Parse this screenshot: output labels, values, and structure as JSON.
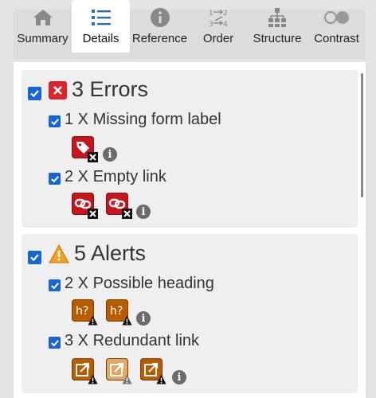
{
  "tabs": [
    {
      "label": "Summary",
      "icon": "home-icon",
      "active": false
    },
    {
      "label": "Details",
      "icon": "list-icon",
      "active": true
    },
    {
      "label": "Reference",
      "icon": "info-icon",
      "active": false
    },
    {
      "label": "Order",
      "icon": "order-icon",
      "active": false
    },
    {
      "label": "Structure",
      "icon": "structure-icon",
      "active": false
    },
    {
      "label": "Contrast",
      "icon": "contrast-icon",
      "active": false
    }
  ],
  "errors": {
    "title": "3 Errors",
    "checked": true,
    "items": [
      {
        "label": "1 X Missing form label",
        "checked": true,
        "icon": "missing-label-icon",
        "count": 1
      },
      {
        "label": "2 X Empty link",
        "checked": true,
        "icon": "empty-link-icon",
        "count": 2
      }
    ]
  },
  "alerts": {
    "title": "5 Alerts",
    "checked": true,
    "items": [
      {
        "label": "2 X Possible heading",
        "checked": true,
        "icon": "possible-heading-icon",
        "count": 2
      },
      {
        "label": "3 X Redundant link",
        "checked": true,
        "icon": "redundant-link-icon",
        "count": 3
      }
    ]
  },
  "colors": {
    "error": "#c4161c",
    "alert": "#b95c00",
    "checkbox": "#1565d8"
  }
}
